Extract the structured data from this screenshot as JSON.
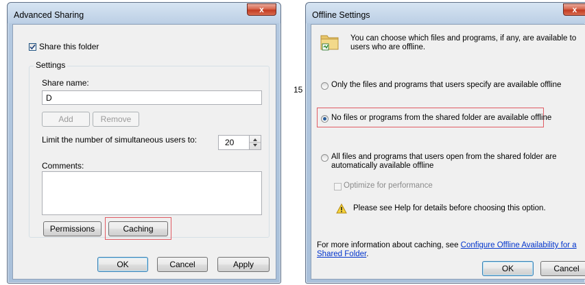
{
  "colors": {
    "highlight": "#e05a62",
    "link": "#0033cc",
    "window_frame": "#b4c9e0",
    "close_button": "#c8452c"
  },
  "page_number": "15",
  "advanced_sharing": {
    "title": "Advanced Sharing",
    "share_checkbox_label": "Share this folder",
    "share_checked": true,
    "settings_group": "Settings",
    "share_name_label": "Share name:",
    "share_name_value": "D",
    "add_button": "Add",
    "remove_button": "Remove",
    "limit_label": "Limit the number of simultaneous users to:",
    "limit_value": "20",
    "comments_label": "Comments:",
    "comments_value": "",
    "permissions_button": "Permissions",
    "caching_button": "Caching",
    "ok_button": "OK",
    "cancel_button": "Cancel",
    "apply_button": "Apply",
    "close_glyph": "x"
  },
  "offline_settings": {
    "title": "Offline Settings",
    "intro": "You can choose which files and programs, if any, are available to users who are offline.",
    "option1": "Only the files and programs that users specify are available offline",
    "option2": "No files or programs from the shared folder are available offline",
    "option3": "All files and programs that users open from the shared folder are automatically available offline",
    "selected_option": 2,
    "optimize_label": "Optimize for performance",
    "warning_text": "Please see Help for details before choosing this option.",
    "more_info_prefix": "For more information about caching, see ",
    "more_info_link": "Configure Offline Availability for a Shared Folder",
    "more_info_suffix": ".",
    "ok_button": "OK",
    "cancel_button": "Cancel",
    "close_glyph": "x"
  }
}
